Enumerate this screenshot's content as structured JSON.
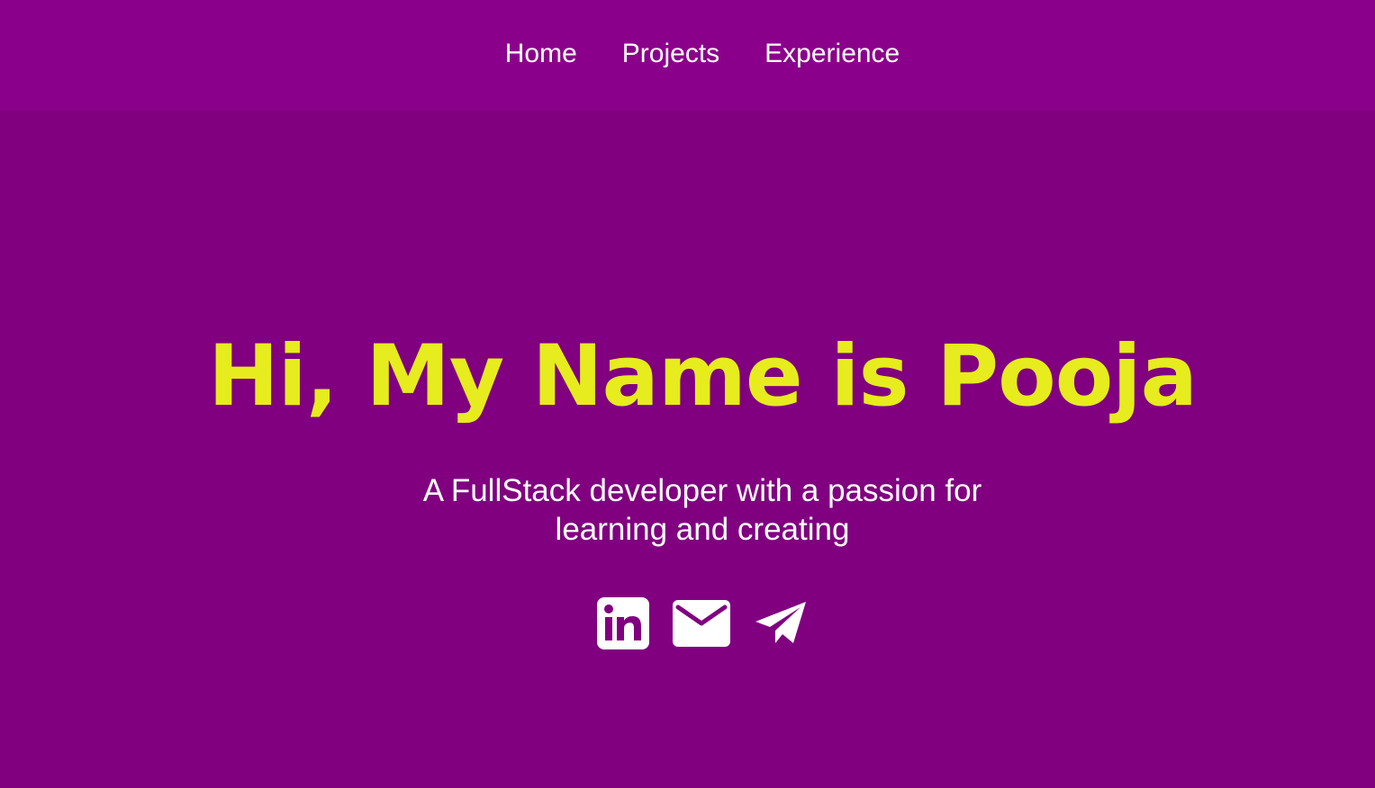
{
  "nav": {
    "items": [
      {
        "label": "Home"
      },
      {
        "label": "Projects"
      },
      {
        "label": "Experience"
      }
    ]
  },
  "hero": {
    "title": "Hi, My Name is Pooja",
    "subtitle_line1": "A FullStack developer with a passion for",
    "subtitle_line2": "learning and creating"
  },
  "social": {
    "icons": [
      "linkedin-icon",
      "mail-icon",
      "telegram-icon"
    ]
  },
  "colors": {
    "background": "#800080",
    "navbar": "#8b008b",
    "accent": "#e6ec1d",
    "text": "#ffffff"
  }
}
